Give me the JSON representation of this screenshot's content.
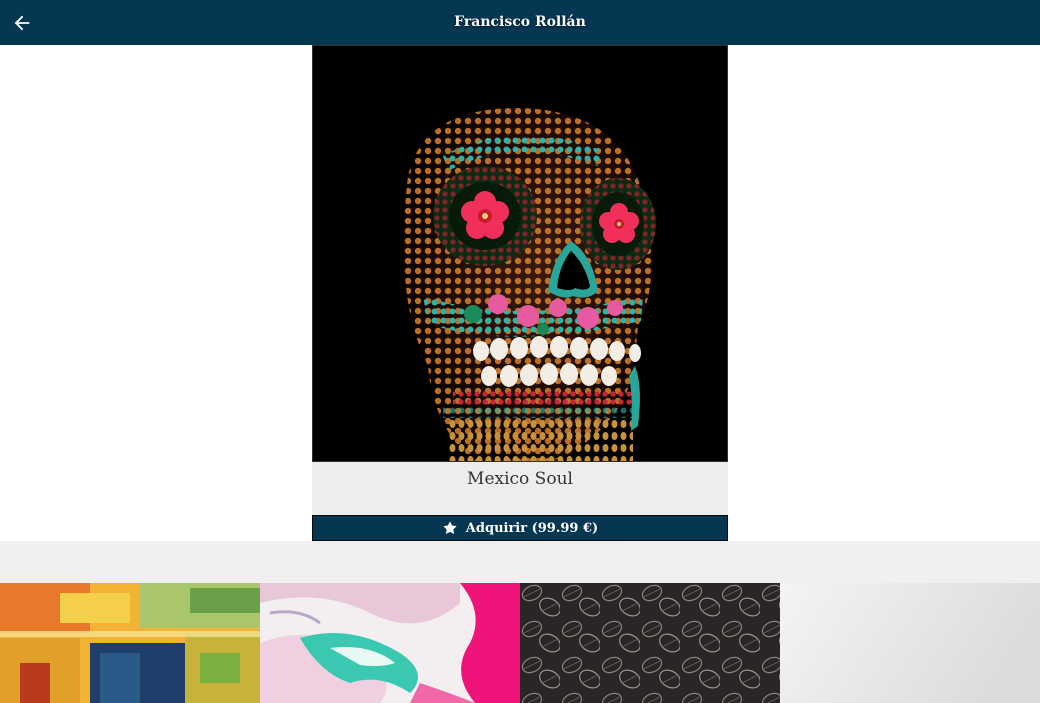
{
  "header": {
    "title": "Francisco Rollán",
    "back_icon": "arrow-left-icon"
  },
  "artwork": {
    "title": "Mexico Soul",
    "buy_label": "Adquirir (99.99 €)",
    "buy_icon": "star-icon"
  },
  "colors": {
    "primary": "#053652",
    "caption_bg": "#ededed",
    "band_bg": "#f0f0f0"
  },
  "thumbnails": [
    {
      "id": "abstract-yellow"
    },
    {
      "id": "marble-pink-teal"
    },
    {
      "id": "leaves-dark"
    },
    {
      "id": "gray-gradient"
    }
  ]
}
